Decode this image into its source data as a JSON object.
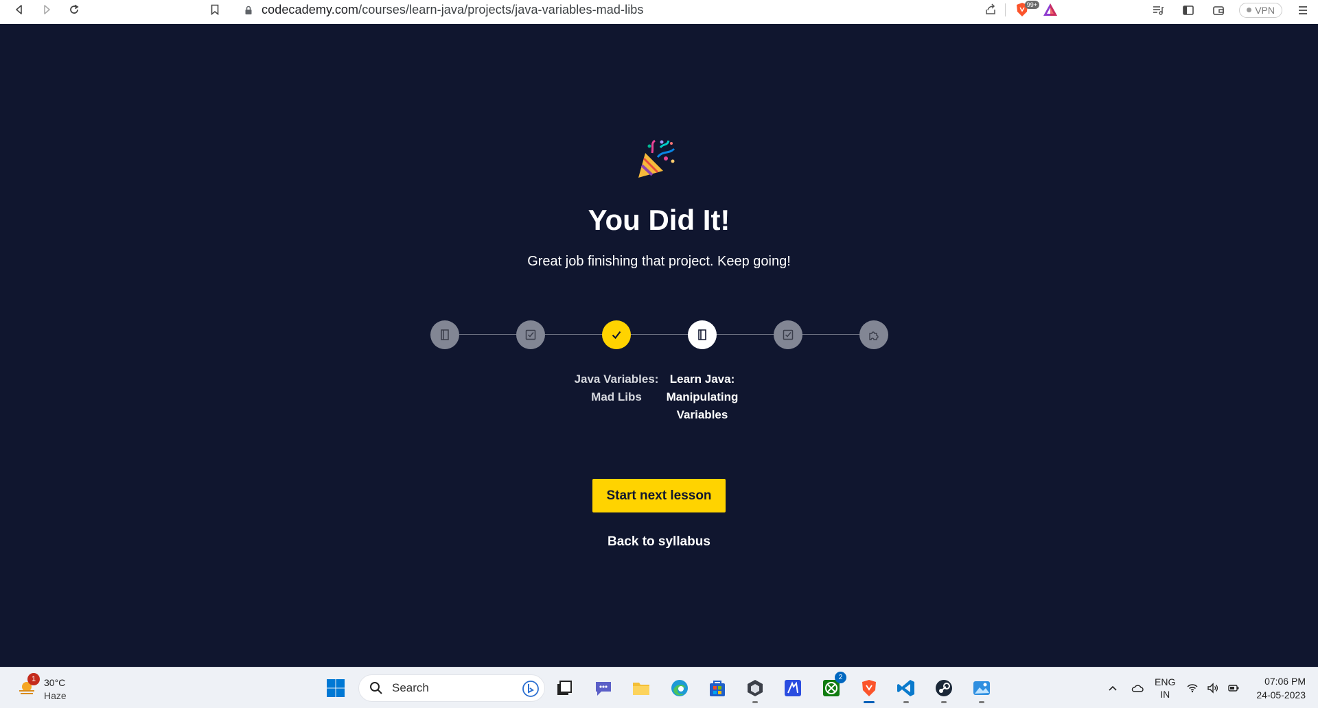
{
  "browser": {
    "url_host": "codecademy.com",
    "url_path": "/courses/learn-java/projects/java-variables-mad-libs",
    "shield_badge": "99+",
    "vpn_label": "VPN"
  },
  "main": {
    "title": "You Did It!",
    "subtitle": "Great job finishing that project. Keep going!",
    "steps": [
      {
        "state": "upcoming",
        "icon": "book-icon"
      },
      {
        "state": "upcoming",
        "icon": "quiz-icon"
      },
      {
        "state": "done",
        "icon": "check-icon",
        "label": "Java Variables: Mad Libs"
      },
      {
        "state": "current",
        "icon": "book-icon",
        "label": "Learn Java: Manipulating Variables"
      },
      {
        "state": "upcoming",
        "icon": "quiz-icon"
      },
      {
        "state": "upcoming",
        "icon": "puzzle-icon"
      }
    ],
    "step_labels": {
      "done_line1": "Java Variables:",
      "done_line2": "Mad Libs",
      "current_line1": "Learn Java:",
      "current_line2": "Manipulating",
      "current_line3": "Variables"
    },
    "cta_label": "Start next lesson",
    "back_label": "Back to syllabus",
    "accent_color": "#ffd300",
    "background_color": "#10162f"
  },
  "taskbar": {
    "weather_temp": "30°C",
    "weather_cond": "Haze",
    "weather_badge": "1",
    "search_placeholder": "Search",
    "xbox_badge": "2",
    "lang_line1": "ENG",
    "lang_line2": "IN",
    "time": "07:06 PM",
    "date": "24-05-2023"
  }
}
